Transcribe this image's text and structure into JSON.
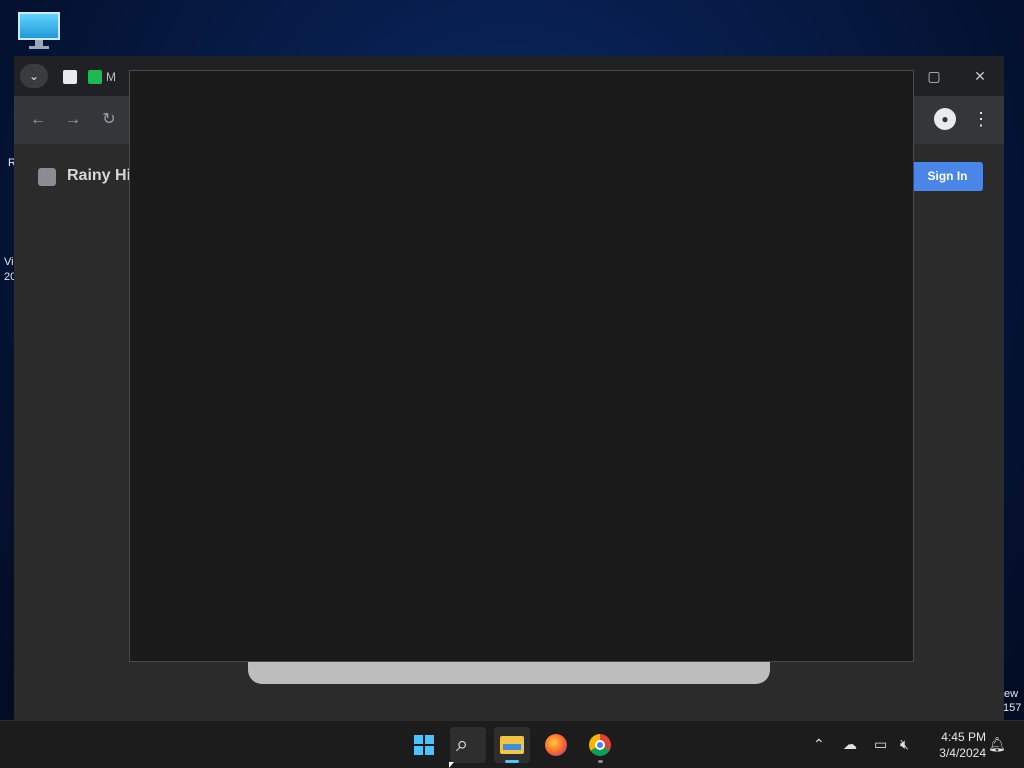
{
  "desktop": {
    "icon_name": "this-pc-icon",
    "side_text_r": "R",
    "side_text_vi": "Vi",
    "side_text_20": "20",
    "side_text_ew": "ew",
    "side_text_157": "157"
  },
  "browser": {
    "tab_title_partial": "M",
    "site_title_partial": "Rainy Hig",
    "sign_in_label": "Sign In",
    "icons": {
      "back": "arrow-left-icon",
      "forward": "arrow-right-icon",
      "reload": "reload-icon",
      "profile": "profile-icon",
      "menu": "more-vert-icon"
    }
  },
  "taskbar": {
    "time": "4:45 PM",
    "date": "3/4/2024",
    "apps": [
      "start",
      "search",
      "file-explorer",
      "firefox",
      "chrome"
    ]
  },
  "colors": {
    "accent": "#4cc2ff",
    "sign_in": "#4a86e8",
    "overlay": "#1a1a1a"
  }
}
